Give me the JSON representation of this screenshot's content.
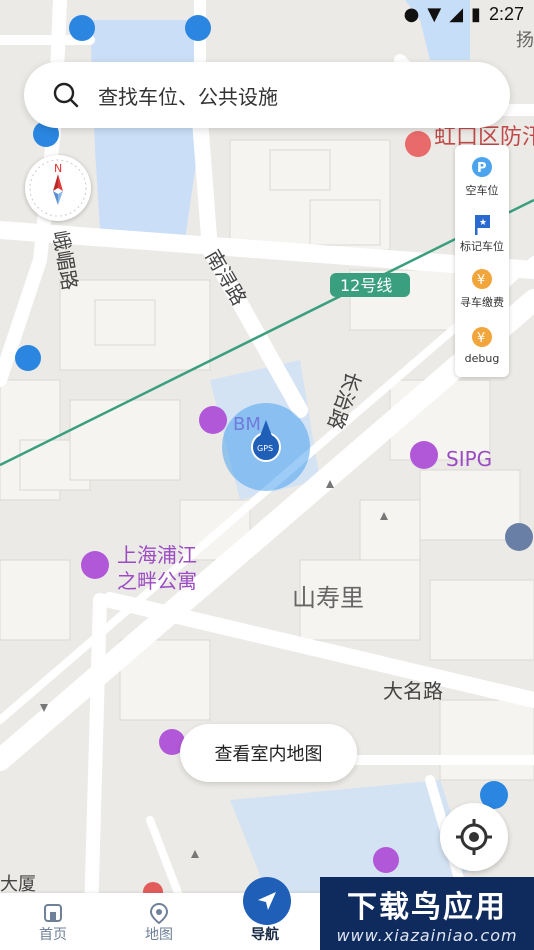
{
  "status_bar": {
    "time": "2:27"
  },
  "search": {
    "placeholder": "查找车位、公共设施"
  },
  "compass": {
    "north_label": "N"
  },
  "side_panel": {
    "items": [
      {
        "label": "空车位",
        "icon": "parking-icon"
      },
      {
        "label": "标记车位",
        "icon": "flag-icon"
      },
      {
        "label": "寻车缴费",
        "icon": "yen-icon"
      },
      {
        "label": "debug",
        "icon": "yen-icon"
      }
    ]
  },
  "map": {
    "labels": {
      "hongkou": "虹口区防汛物资储备中",
      "yang": "扬",
      "line12": "12号线",
      "nanxun": "南浔路",
      "ezui": "峨嵋路",
      "changzhi": "长治路",
      "bm": "BM",
      "sipg": "SIPG",
      "shanghai_apt_1": "上海浦江",
      "shanghai_apt_2": "之畔公寓",
      "shanshouli": "山寿里",
      "daming": "大名路",
      "dasha": "大厦",
      "gps": "GPS"
    },
    "colors": {
      "water": "#c7def8",
      "road": "#ffffff",
      "block": "#f5f4f0",
      "metro": "#3a9f7f",
      "poi": "#b158d8",
      "location": "#4ca3ee"
    }
  },
  "indoor_button": {
    "label": "查看室内地图"
  },
  "bottom_nav": {
    "tabs": [
      {
        "label": "首页",
        "icon": "home-icon"
      },
      {
        "label": "地图",
        "icon": "map-pin-icon"
      },
      {
        "label": "导航",
        "icon": "navigation-icon"
      }
    ]
  },
  "watermark": {
    "title": "下载鸟应用",
    "url": "www.xiazainiao.com"
  }
}
